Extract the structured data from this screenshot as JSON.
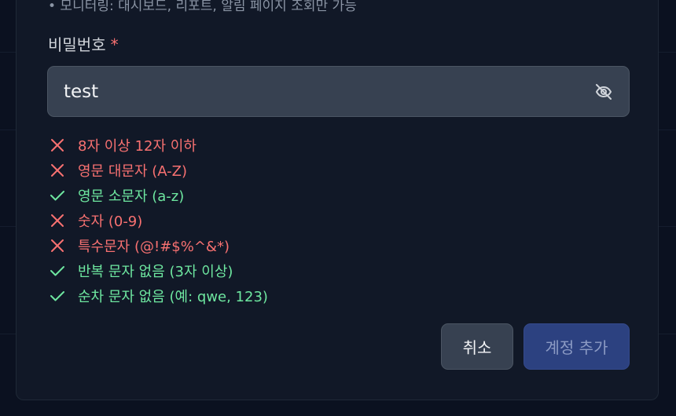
{
  "header": {
    "partial_text": "• 모니터링: 대시보드, 리포트, 알림 페이지 조회만 가능"
  },
  "password": {
    "label": "비밀번호",
    "required_mark": "*",
    "value": "test",
    "visibility_icon": "eye-off-icon"
  },
  "rules": [
    {
      "label": "8자 이상 12자 이하",
      "status": "fail",
      "icon": "x-icon"
    },
    {
      "label": "영문 대문자 (A-Z)",
      "status": "fail",
      "icon": "x-icon"
    },
    {
      "label": "영문 소문자 (a-z)",
      "status": "pass",
      "icon": "check-icon"
    },
    {
      "label": "숫자 (0-9)",
      "status": "fail",
      "icon": "x-icon"
    },
    {
      "label": "특수문자 (@!#$%^&*)",
      "status": "fail",
      "icon": "x-icon"
    },
    {
      "label": "반복 문자 없음 (3자 이상)",
      "status": "pass",
      "icon": "check-icon"
    },
    {
      "label": "순차 문자 없음 (예: qwe, 123)",
      "status": "pass",
      "icon": "check-icon"
    }
  ],
  "actions": {
    "cancel_label": "취소",
    "submit_label": "계정 추가",
    "submit_disabled": true
  },
  "colors": {
    "fail": "#f87171",
    "pass": "#6ee7a0",
    "primary_disabled": "#2c4180",
    "surface": "#111827",
    "input_bg": "#374151"
  }
}
